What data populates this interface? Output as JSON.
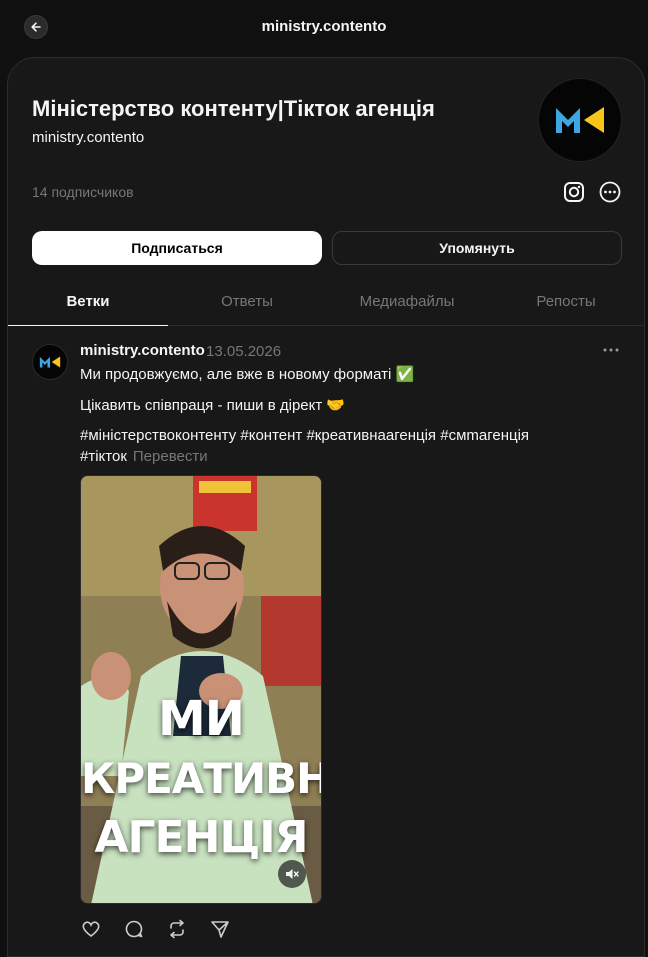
{
  "topbar": {
    "title": "ministry.contento",
    "back_icon": "arrow-left-icon"
  },
  "profile": {
    "name": "Міністерство контенту|Тікток агенція",
    "handle": "ministry.contento",
    "followers": "14 подписчиков",
    "follow_label": "Подписаться",
    "mention_label": "Упомянуть"
  },
  "tabs": [
    "Ветки",
    "Ответы",
    "Медиафайлы",
    "Репосты"
  ],
  "post": {
    "author": "ministry.contento",
    "date": "13.05.2026",
    "line1": "Ми продовжуємо, але вже в новому форматі ✅",
    "line2": "Цікавить співпраця - пиши в дірект 🤝",
    "hashtags_line1": "#міністерствоконтенту #контент #креативнаагенція #смmагенція",
    "hashtags_line2": "#тікток",
    "translate": "Перевести",
    "video_text": [
      "МИ",
      "КРЕАТИВНА",
      "АГЕНЦІЯ"
    ]
  },
  "colors": {
    "background": "#101010",
    "panel": "#181818",
    "muted": "#777777",
    "logo_blue": "#3ea6e0",
    "logo_yellow": "#f5c518"
  }
}
